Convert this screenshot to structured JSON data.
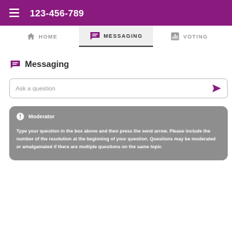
{
  "header": {
    "meeting_code": "123-456-789",
    "menu_icon": "hamburger-menu-icon",
    "background_color": "#8a1a7e"
  },
  "tabs": [
    {
      "label": "HOME",
      "icon": "home-icon",
      "active": false
    },
    {
      "label": "MESSAGING",
      "icon": "chat-icon",
      "active": true
    },
    {
      "label": "VOTING",
      "icon": "bar-chart-icon",
      "active": false
    }
  ],
  "messaging": {
    "title": "Messaging",
    "title_icon": "chat-icon",
    "accent_color": "#8a1a7e",
    "ask_input": {
      "placeholder": "Ask a question",
      "value": ""
    },
    "send_icon": "send-arrow-icon"
  },
  "notice": {
    "icon": "alert-icon",
    "title": "Moderator",
    "body": "Type your question in the box above and then press the send arrow. Please include the number of the resolution at the beginning of your question. Questions may be moderated or amalgamated if there are multiple questions on the same topic",
    "background_color": "#8e8e8e"
  }
}
